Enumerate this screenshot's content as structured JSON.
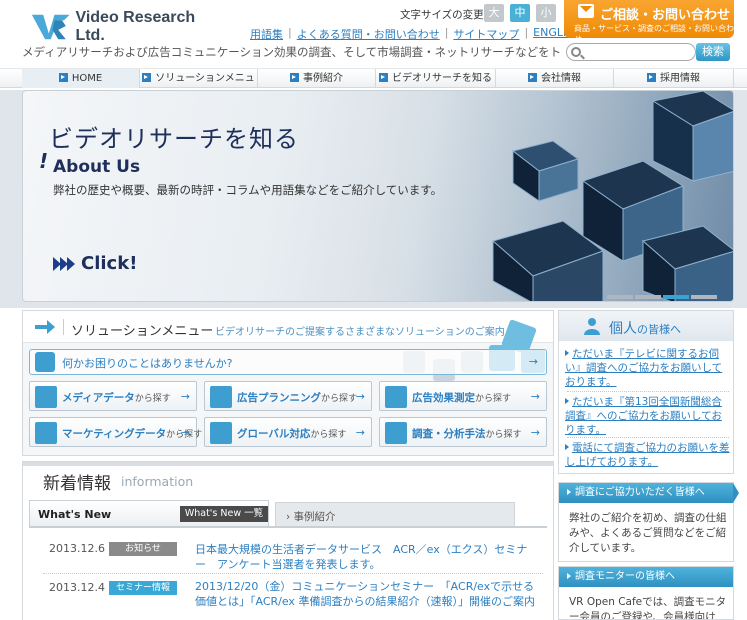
{
  "header": {
    "logo_text": "Video Research Ltd.",
    "tagline": "メディアリサーチおよび広告コミュニケーション効果の調査、そして市場調査・ネットリサーチなどをトータルサポート",
    "font_size_label": "文字サイズの変更",
    "font_sizes": [
      "大",
      "中",
      "小"
    ],
    "utility_links": [
      "用語集",
      "よくある質問・お問い合わせ",
      "サイトマップ",
      "ENGLISH"
    ],
    "contact": {
      "title": "ご相談・お問い合わせ",
      "sub": "商品・サービス・調査のご相談・お問い合わせ"
    },
    "search": {
      "placeholder": "",
      "button": "検索"
    }
  },
  "nav": [
    "HOME",
    "ソリューションメニュー",
    "事例紹介",
    "ビデオリサーチを知る",
    "会社情報",
    "採用情報"
  ],
  "hero": {
    "title": "ビデオリサーチを知る",
    "subtitle": "About Us",
    "bang": "!",
    "description": "弊社の歴史や概要、最新の時評・コラムや用語集などをご紹介しています。",
    "cta": "Click",
    "cta_bang": "!"
  },
  "solution": {
    "title": "ソリューションメニュー",
    "description": "ビデオリサーチのご提案するさまざまなソリューションのご案内",
    "question": "何かお困りのことはありませんか?",
    "buttons": [
      {
        "label": "メディアデータ",
        "suffix": "から探す"
      },
      {
        "label": "広告プランニング",
        "suffix": "から探す"
      },
      {
        "label": "広告効果測定",
        "suffix": "から探す"
      },
      {
        "label": "マーケティングデータ",
        "suffix": "から探す"
      },
      {
        "label": "グローバル対応",
        "suffix": "から探す"
      },
      {
        "label": "調査・分析手法",
        "suffix": "から探す"
      }
    ],
    "go": "→"
  },
  "news": {
    "title": "新着情報",
    "title_en": "information",
    "tab_whatsnew": "What's New",
    "whatsnew_list": "What's New 一覧",
    "tab_cases": "事例紹介",
    "items": [
      {
        "date": "2013.12.6",
        "badge": "お知らせ",
        "badge_color": "#8a8a8a",
        "text": "日本最大規模の生活者データサービス　ACR／ex（エクス）セミナー　アンケート当選者を発表します。"
      },
      {
        "date": "2013.12.4",
        "badge": "セミナー情報",
        "badge_color": "#3aa8d6",
        "text": "2013/12/20（金）コミュニケーションセミナー　「ACR/exで示せる価値とは」「ACR/ex 準備調査からの結果紹介（速報）」開催のご案内"
      }
    ]
  },
  "personal": {
    "title": "個人",
    "title_suffix": "の皆様へ",
    "links": [
      "ただいま『テレビに関するお伺い』調査へのご協力をお願いしております。",
      "ただいま『第13回全国新聞総合調査』へのご協力をお願いしております。",
      "電話にて調査ご協力のお願いを差し上げております。"
    ]
  },
  "side_boxes": [
    {
      "head": "調査にご協力いただく皆様へ",
      "body": "弊社のご紹介を初め、調査の仕組みや、よくあるご質問などをご紹介しています。"
    },
    {
      "head": "調査モニターの皆様へ",
      "body": "VR Open Cafeでは、調査モニター会員のご登録や、会員様向け"
    }
  ],
  "colors": {
    "accent": "#2c7fc1",
    "orange": "#ef8a05",
    "navy": "#1d2f5a"
  }
}
